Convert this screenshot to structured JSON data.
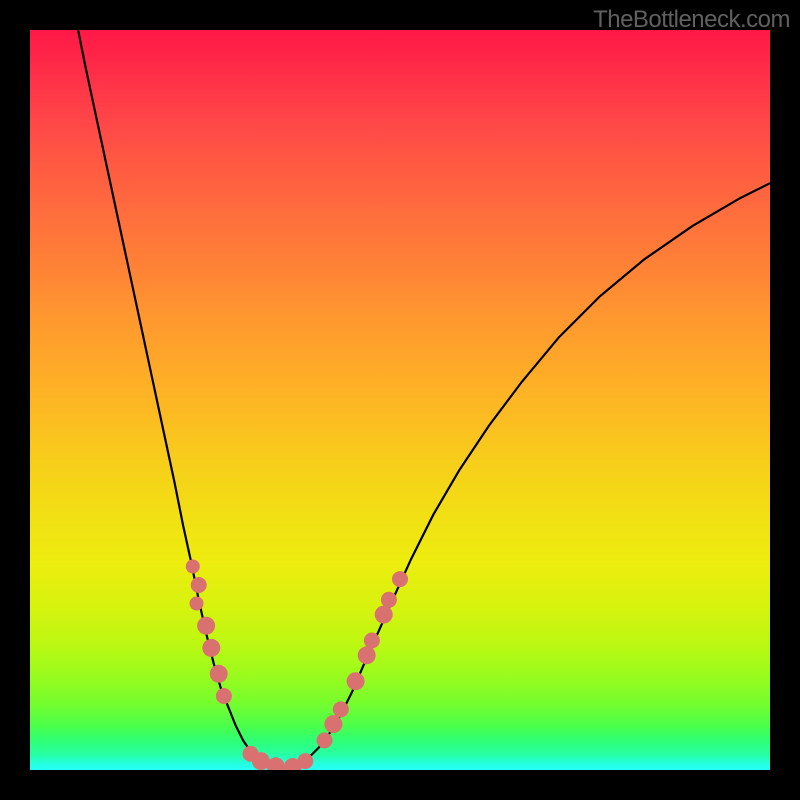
{
  "watermark": "TheBottleneck.com",
  "chart_data": {
    "type": "line",
    "title": "",
    "xlabel": "",
    "ylabel": "",
    "xlim": [
      0,
      1
    ],
    "ylim": [
      0,
      1
    ],
    "curve": [
      {
        "x": 0.065,
        "y": 1.0
      },
      {
        "x": 0.075,
        "y": 0.95
      },
      {
        "x": 0.09,
        "y": 0.88
      },
      {
        "x": 0.105,
        "y": 0.81
      },
      {
        "x": 0.12,
        "y": 0.74
      },
      {
        "x": 0.135,
        "y": 0.67
      },
      {
        "x": 0.15,
        "y": 0.6
      },
      {
        "x": 0.165,
        "y": 0.53
      },
      {
        "x": 0.18,
        "y": 0.46
      },
      {
        "x": 0.195,
        "y": 0.39
      },
      {
        "x": 0.207,
        "y": 0.33
      },
      {
        "x": 0.218,
        "y": 0.28
      },
      {
        "x": 0.228,
        "y": 0.23
      },
      {
        "x": 0.238,
        "y": 0.185
      },
      {
        "x": 0.248,
        "y": 0.145
      },
      {
        "x": 0.258,
        "y": 0.11
      },
      {
        "x": 0.268,
        "y": 0.085
      },
      {
        "x": 0.278,
        "y": 0.06
      },
      {
        "x": 0.288,
        "y": 0.04
      },
      {
        "x": 0.298,
        "y": 0.025
      },
      {
        "x": 0.308,
        "y": 0.015
      },
      {
        "x": 0.318,
        "y": 0.008
      },
      {
        "x": 0.33,
        "y": 0.004
      },
      {
        "x": 0.345,
        "y": 0.003
      },
      {
        "x": 0.36,
        "y": 0.006
      },
      {
        "x": 0.375,
        "y": 0.015
      },
      {
        "x": 0.39,
        "y": 0.03
      },
      {
        "x": 0.405,
        "y": 0.05
      },
      {
        "x": 0.42,
        "y": 0.075
      },
      {
        "x": 0.435,
        "y": 0.105
      },
      {
        "x": 0.45,
        "y": 0.14
      },
      {
        "x": 0.47,
        "y": 0.185
      },
      {
        "x": 0.49,
        "y": 0.23
      },
      {
        "x": 0.515,
        "y": 0.285
      },
      {
        "x": 0.545,
        "y": 0.345
      },
      {
        "x": 0.58,
        "y": 0.405
      },
      {
        "x": 0.62,
        "y": 0.465
      },
      {
        "x": 0.665,
        "y": 0.525
      },
      {
        "x": 0.715,
        "y": 0.585
      },
      {
        "x": 0.77,
        "y": 0.64
      },
      {
        "x": 0.83,
        "y": 0.69
      },
      {
        "x": 0.895,
        "y": 0.735
      },
      {
        "x": 0.96,
        "y": 0.773
      },
      {
        "x": 1.0,
        "y": 0.793
      }
    ],
    "dots": [
      {
        "x": 0.22,
        "y": 0.275,
        "r": 7
      },
      {
        "x": 0.228,
        "y": 0.25,
        "r": 8
      },
      {
        "x": 0.225,
        "y": 0.225,
        "r": 7
      },
      {
        "x": 0.238,
        "y": 0.195,
        "r": 9
      },
      {
        "x": 0.245,
        "y": 0.165,
        "r": 9
      },
      {
        "x": 0.255,
        "y": 0.13,
        "r": 9
      },
      {
        "x": 0.262,
        "y": 0.1,
        "r": 8
      },
      {
        "x": 0.298,
        "y": 0.022,
        "r": 8
      },
      {
        "x": 0.312,
        "y": 0.012,
        "r": 9
      },
      {
        "x": 0.332,
        "y": 0.005,
        "r": 9
      },
      {
        "x": 0.355,
        "y": 0.004,
        "r": 9
      },
      {
        "x": 0.372,
        "y": 0.012,
        "r": 8
      },
      {
        "x": 0.398,
        "y": 0.04,
        "r": 8
      },
      {
        "x": 0.41,
        "y": 0.062,
        "r": 9
      },
      {
        "x": 0.42,
        "y": 0.082,
        "r": 8
      },
      {
        "x": 0.44,
        "y": 0.12,
        "r": 9
      },
      {
        "x": 0.455,
        "y": 0.155,
        "r": 9
      },
      {
        "x": 0.462,
        "y": 0.175,
        "r": 8
      },
      {
        "x": 0.478,
        "y": 0.21,
        "r": 9
      },
      {
        "x": 0.485,
        "y": 0.23,
        "r": 8
      },
      {
        "x": 0.5,
        "y": 0.258,
        "r": 8
      }
    ]
  }
}
